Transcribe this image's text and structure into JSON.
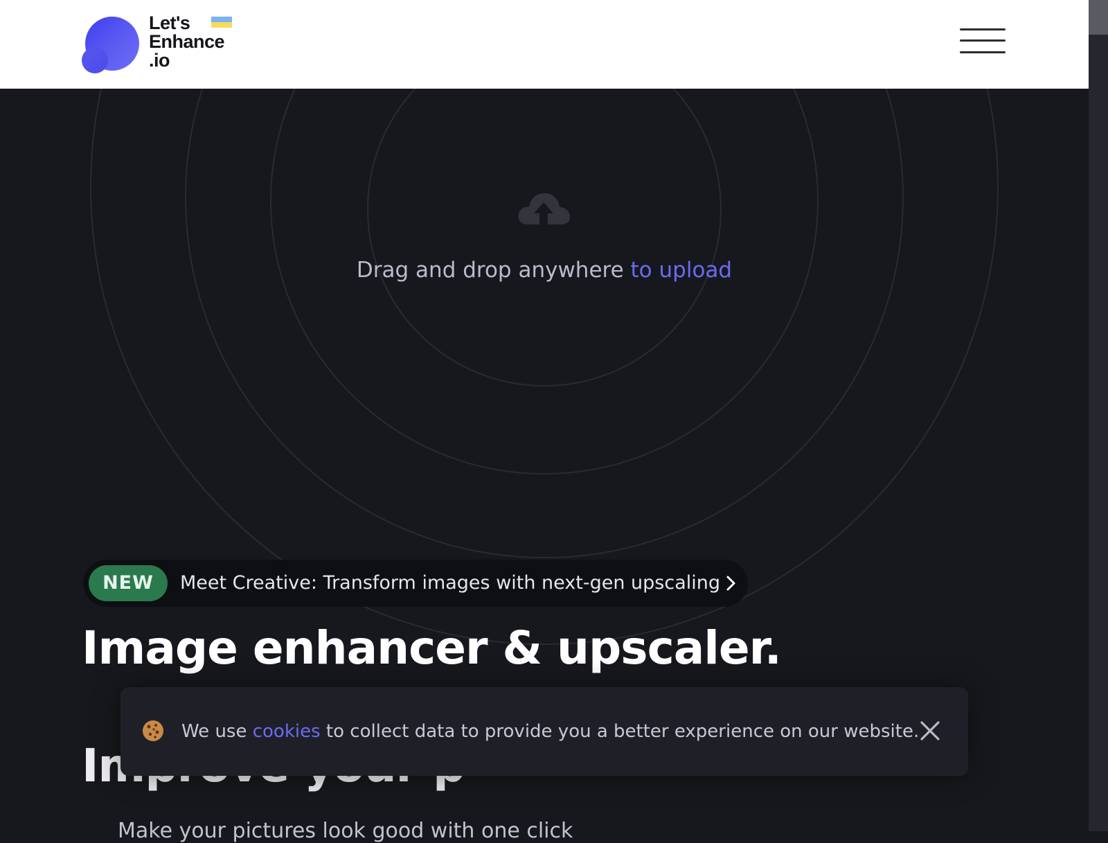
{
  "header": {
    "logo_text": [
      "Let's",
      "Enhance",
      ".io"
    ],
    "menu_icon": "hamburger-icon"
  },
  "upload": {
    "icon": "cloud-upload-icon",
    "text": "Drag and drop anywhere ",
    "link": "to upload"
  },
  "announcement": {
    "badge": "NEW",
    "text": "Meet Creative: Transform images with next-gen upscaling",
    "icon": "chevron-right-icon"
  },
  "hero": {
    "title": "Image enhancer & upscaler.",
    "second_title_partial": "Improve your p",
    "subtitle_partial": "Make your pictures look good with one click"
  },
  "cookie_banner": {
    "icon": "cookie-icon",
    "text_before": "We use ",
    "link": "cookies",
    "text_after": " to collect data to provide you a better experience on our website.",
    "close_icon": "close-icon"
  },
  "colors": {
    "background": "#17181d",
    "accent": "#6a6cf2",
    "badge_green": "#2a7a4e",
    "header_bg": "#ffffff"
  }
}
